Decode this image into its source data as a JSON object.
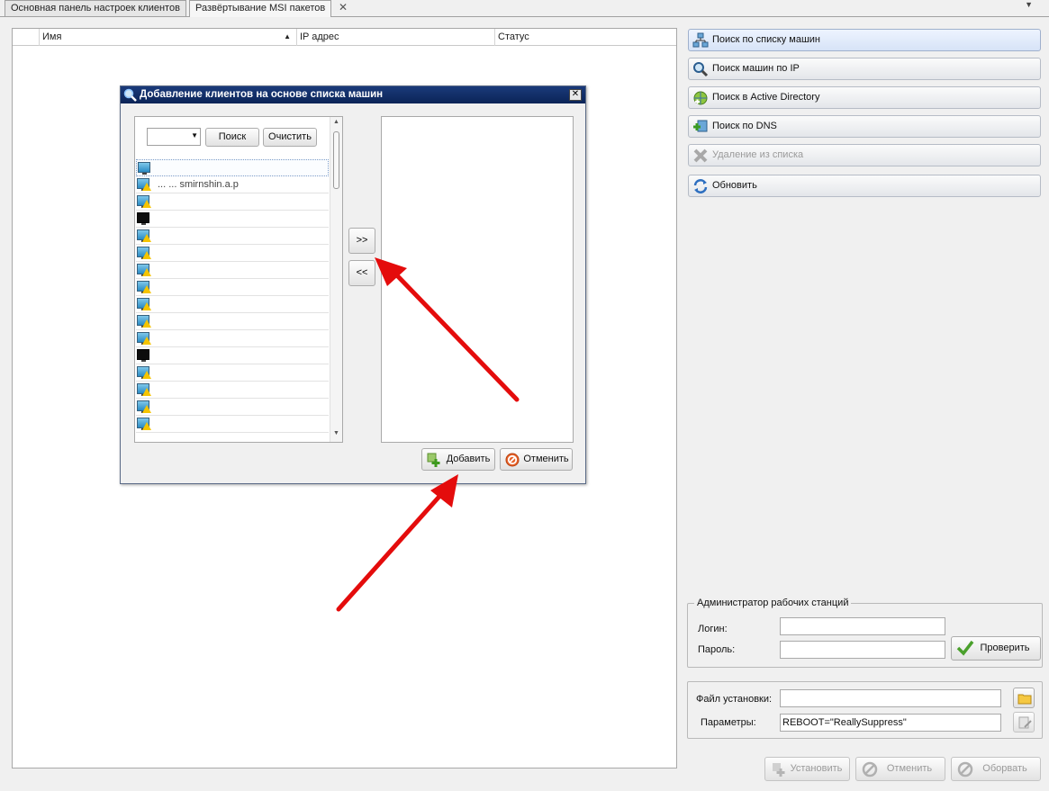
{
  "tabs": [
    {
      "label": "Основная панель настроек клиентов",
      "active": false
    },
    {
      "label": "Развёртывание MSI пакетов",
      "active": true
    }
  ],
  "table": {
    "columns": [
      "Имя",
      "IP адрес",
      "Статус"
    ],
    "sort_indicator": "▲"
  },
  "right_actions": [
    {
      "label": "Поиск по списку машин",
      "icon": "network-search-icon",
      "enabled": true
    },
    {
      "label": "Поиск машин по IP",
      "icon": "magnifier-icon",
      "enabled": true
    },
    {
      "label": "Поиск в Active Directory",
      "icon": "globe-add-icon",
      "enabled": true
    },
    {
      "label": "Поиск по DNS",
      "icon": "dns-add-icon",
      "enabled": true
    },
    {
      "label": "Удаление из списка",
      "icon": "delete-x-icon",
      "enabled": false
    },
    {
      "label": "Обновить",
      "icon": "refresh-icon",
      "enabled": true
    }
  ],
  "admin_group": {
    "title": "Администратор рабочих станций",
    "login_label": "Логин:",
    "login_value": "",
    "password_label": "Пароль:",
    "password_value": "",
    "verify_button": "Проверить"
  },
  "install_group": {
    "file_label": "Файл установки:",
    "file_value": "",
    "params_label": "Параметры:",
    "params_value": "REBOOT=\"ReallySuppress\""
  },
  "bottom_buttons": [
    {
      "label": "Установить",
      "enabled": false
    },
    {
      "label": "Отменить",
      "enabled": false
    },
    {
      "label": "Оборвать",
      "enabled": false
    }
  ],
  "dialog": {
    "title": "Добавление клиентов на основе списка машин",
    "search_button": "Поиск",
    "clear_button": "Очистить",
    "move_right": ">>",
    "move_left": "<<",
    "add_button": "Добавить",
    "cancel_button": "Отменить",
    "machine_rows": [
      {
        "icon": "monitor-icon",
        "warning": false,
        "text": ""
      },
      {
        "icon": "monitor-icon",
        "warning": true,
        "text": "  ...  ...  smirnshin.a.p"
      },
      {
        "icon": "monitor-icon",
        "warning": true,
        "text": ""
      },
      {
        "icon": "monitor-icon",
        "warning": false,
        "text": ""
      },
      {
        "icon": "monitor-icon",
        "warning": true,
        "text": ""
      },
      {
        "icon": "monitor-icon",
        "warning": true,
        "text": ""
      },
      {
        "icon": "monitor-icon",
        "warning": true,
        "text": ""
      },
      {
        "icon": "monitor-icon",
        "warning": true,
        "text": ""
      },
      {
        "icon": "monitor-icon",
        "warning": true,
        "text": ""
      },
      {
        "icon": "monitor-icon",
        "warning": true,
        "text": ""
      },
      {
        "icon": "monitor-icon",
        "warning": true,
        "text": ""
      },
      {
        "icon": "monitor-icon",
        "warning": false,
        "text": ""
      },
      {
        "icon": "monitor-icon",
        "warning": true,
        "text": ""
      },
      {
        "icon": "monitor-icon",
        "warning": true,
        "text": ""
      },
      {
        "icon": "monitor-icon",
        "warning": true,
        "text": ""
      },
      {
        "icon": "monitor-icon",
        "warning": true,
        "text": ""
      }
    ]
  }
}
